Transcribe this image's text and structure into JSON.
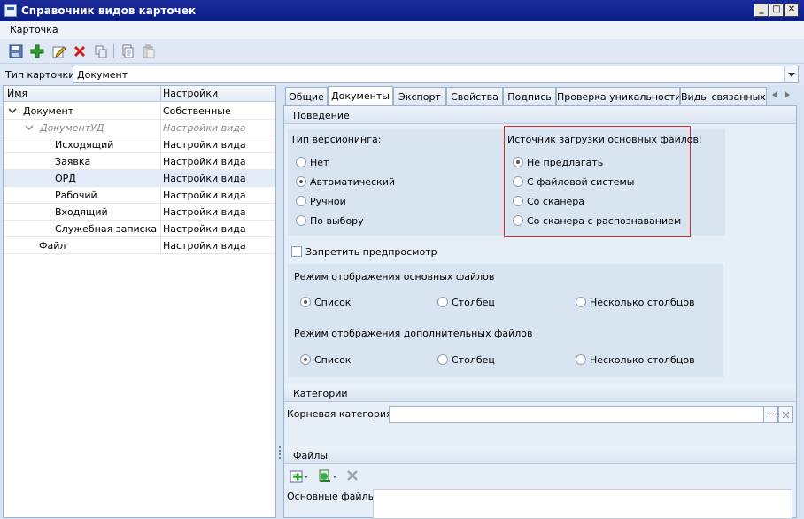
{
  "window": {
    "title": "Справочник видов карточек"
  },
  "menu": {
    "card": "Карточка"
  },
  "type_row": {
    "label": "Тип карточки:",
    "value": "Документ"
  },
  "tree": {
    "col_name": "Имя",
    "col_settings": "Настройки",
    "rows": [
      {
        "name": "Документ",
        "settings": "Собственные"
      },
      {
        "name": "ДокументУД",
        "settings": "Настройки вида"
      },
      {
        "name": "Исходящий",
        "settings": "Настройки вида"
      },
      {
        "name": "Заявка",
        "settings": "Настройки вида"
      },
      {
        "name": "ОРД",
        "settings": "Настройки вида"
      },
      {
        "name": "Рабочий",
        "settings": "Настройки вида"
      },
      {
        "name": "Входящий",
        "settings": "Настройки вида"
      },
      {
        "name": "Служебная записка",
        "settings": "Настройки вида"
      },
      {
        "name": "Файл",
        "settings": "Настройки вида"
      }
    ]
  },
  "tabs": [
    "Общие",
    "Документы",
    "Экспорт",
    "Свойства",
    "Подпись",
    "Проверка уникальности",
    "Виды связанных з"
  ],
  "behavior": {
    "header": "Поведение",
    "versioning_label": "Тип версионинга:",
    "versioning_options": [
      "Нет",
      "Автоматический",
      "Ручной",
      "По выбору"
    ],
    "source_label": "Источник загрузки основных файлов:",
    "source_options": [
      "Не предлагать",
      "С файловой системы",
      "Со сканера",
      "Со сканера с распознаванием"
    ],
    "preview_label": "Запретить предпросмотр",
    "main_mode_label": "Режим отображения основных файлов",
    "extra_mode_label": "Режим отображения дополнительных файлов",
    "mode_options": [
      "Список",
      "Столбец",
      "Несколько столбцов"
    ]
  },
  "categories": {
    "header": "Категории",
    "root_label": "Корневая категория:",
    "root_value": "",
    "browse": "···"
  },
  "files": {
    "header": "Файлы",
    "main_files_label": "Основные файлы"
  },
  "colors": {
    "accent_red": "#e0262a",
    "title_bar": "#0a1f86",
    "panel_bg": "#e6eef7"
  }
}
